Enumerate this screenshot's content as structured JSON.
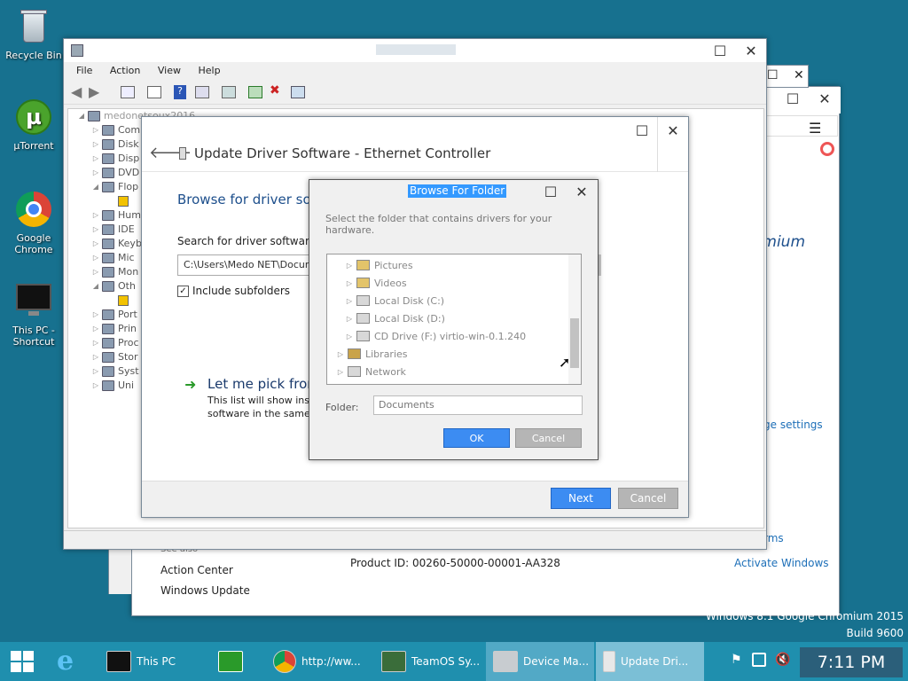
{
  "desktop": {
    "icons": [
      {
        "label": "Recycle Bin"
      },
      {
        "label": "µTorrent"
      },
      {
        "label": "Google Chrome"
      },
      {
        "label": "This PC - Shortcut"
      }
    ],
    "watermark1": "Windows 8.1 Google Chromium 2015",
    "watermark2": "Build 9600"
  },
  "system_window": {
    "see_also": "See also",
    "links": [
      "Action Center",
      "Windows Update"
    ],
    "product_id": "Product ID: 00260-50000-00001-AA328",
    "activate": "Activate Windows",
    "settings_link": "ge settings",
    "terms": "rms",
    "chromium": "omium"
  },
  "device_manager": {
    "menu": [
      "File",
      "Action",
      "View",
      "Help"
    ],
    "root": "medonetsoux2016",
    "items": [
      "Com",
      "Disk",
      "Disp",
      "DVD",
      "Flop",
      "Hum",
      "IDE",
      "Keyb",
      "Mic",
      "Mon",
      "Oth",
      "Port",
      "Prin",
      "Proc",
      "Stor",
      "Syst",
      "Uni"
    ]
  },
  "update_driver": {
    "title": "Update Driver Software - Ethernet Controller",
    "heading": "Browse for driver soft",
    "search_label": "Search for driver software in",
    "path_value": "C:\\Users\\Medo NET\\Docun",
    "include_sub": "Include subfolders",
    "pick_title": "Let me pick from",
    "pick_desc1": "This list will show insta",
    "pick_desc2": "software in the same c",
    "next": "Next",
    "cancel": "Cancel"
  },
  "browse_folder": {
    "title": "Browse For Folder",
    "instruction": "Select the folder that contains drivers for your hardware.",
    "tree": [
      {
        "label": "Pictures",
        "indent": 1
      },
      {
        "label": "Videos",
        "indent": 1
      },
      {
        "label": "Local Disk (C:)",
        "indent": 1
      },
      {
        "label": "Local Disk (D:)",
        "indent": 1
      },
      {
        "label": "CD Drive (F:) virtio-win-0.1.240",
        "indent": 1
      },
      {
        "label": "Libraries",
        "indent": 0
      },
      {
        "label": "Network",
        "indent": 0
      }
    ],
    "folder_label": "Folder:",
    "folder_value": "Documents",
    "ok": "OK",
    "cancel": "Cancel"
  },
  "taskbar": {
    "items": [
      {
        "label": "This PC"
      },
      {
        "label": "http://ww..."
      },
      {
        "label": "TeamOS Sy..."
      },
      {
        "label": "Device Ma..."
      },
      {
        "label": "Update Dri..."
      }
    ],
    "clock": "7:11 PM"
  }
}
